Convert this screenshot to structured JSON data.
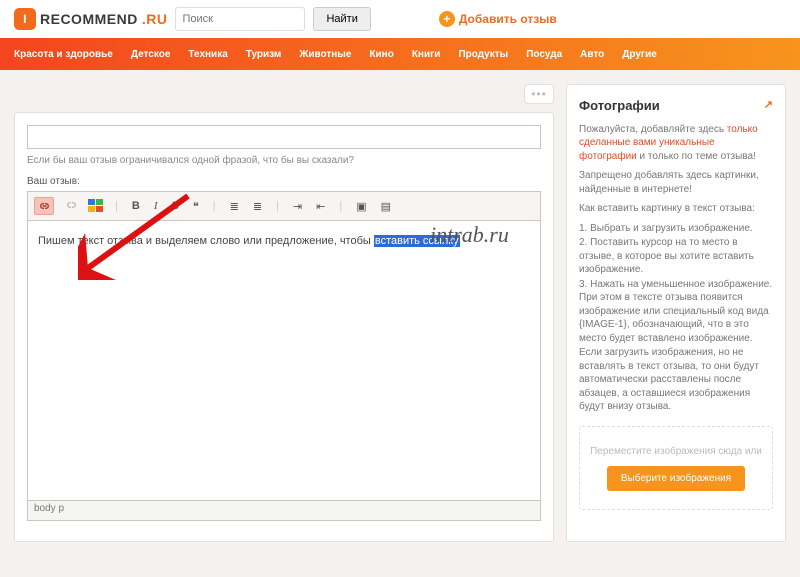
{
  "header": {
    "logo_badge": "I",
    "logo_text": "RECOMMEND",
    "logo_suffix": ".RU",
    "search_placeholder": "Поиск",
    "find_label": "Найти",
    "add_review_label": "Добавить отзыв"
  },
  "nav": {
    "items": [
      "Красота и здоровье",
      "Детское",
      "Техника",
      "Туризм",
      "Животные",
      "Кино",
      "Книги",
      "Продукты",
      "Посуда",
      "Авто",
      "Другие"
    ]
  },
  "editor": {
    "one_phrase_hint": "Если бы ваш отзыв ограничивался одной фразой, что бы вы сказали?",
    "your_review_label": "Ваш отзыв:",
    "content_prefix": "Пишем текст отзыва и выделяем слово или предложение, чтобы ",
    "content_selected": "вставить ссылку",
    "path": "body   p"
  },
  "toolbar": {
    "b": "B",
    "i": "I",
    "s": "S",
    "quote": "❝",
    "ul": "≣",
    "ol": "≣",
    "inc": "⇥",
    "dec": "⇤",
    "img": "▣",
    "src": "▤"
  },
  "sidebar": {
    "title": "Фотографии",
    "intro_a": "Пожалуйста, добавляйте здесь ",
    "intro_b": "только сделанные вами уникальные фотографии",
    "intro_c": " и только по теме отзыва!",
    "intro_d": "Запрещено добавлять здесь картинки, найденные в интернете!",
    "howto_title": "Как вставить картинку в текст отзыва:",
    "steps": [
      "1. Выбрать и загрузить изображение.",
      "2. Поставить курсор на то место в отзыве, в которое вы хотите вставить изображение.",
      "3. Нажать на уменьшенное изображение. При этом в тексте отзыва появится изображение или специальный код вида {IMAGE-1}, обозначающий, что в это место будет вставлено изображение."
    ],
    "note": "Если загрузить изображения, но не вставлять в текст отзыва, то они будут автоматически расставлены после абзацев, а оставшиеся изображения будут внизу отзыва.",
    "drop_hint": "Переместите изображения сюда или",
    "choose_label": "Выберите изображения"
  },
  "watermark": "intrab.ru"
}
